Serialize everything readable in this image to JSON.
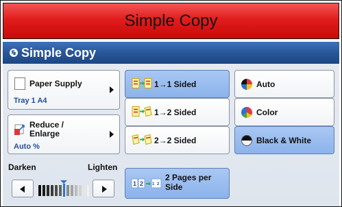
{
  "banner": {
    "title": "Simple Copy"
  },
  "header": {
    "title": "Simple Copy",
    "icon": "copy-icon"
  },
  "paper_supply": {
    "label": "Paper Supply",
    "value": "Tray 1  A4"
  },
  "reduce_enlarge": {
    "label_line1": "Reduce /",
    "label_line2": "Enlarge",
    "value": "Auto %"
  },
  "sided": {
    "items": [
      {
        "label": "1→1 Sided",
        "selected": true
      },
      {
        "label": "1→2 Sided",
        "selected": false
      },
      {
        "label": "2→2 Sided",
        "selected": false
      }
    ]
  },
  "color_mode": {
    "items": [
      {
        "label": "Auto",
        "icon": "auto-color-icon",
        "selected": false
      },
      {
        "label": "Color",
        "icon": "color-wheel-icon",
        "selected": false
      },
      {
        "label": "Black & White",
        "icon": "black-white-icon",
        "selected": true
      }
    ]
  },
  "density": {
    "darken_label": "Darken",
    "lighten_label": "Lighten",
    "level": 0.5
  },
  "pages_per_side": {
    "label_line1": "2 Pages per",
    "label_line2": "Side",
    "selected": true
  },
  "colors": {
    "banner_red": "#e21c1c",
    "header_blue": "#275597",
    "selected_blue": "#9bbdee",
    "value_blue": "#1f4ea3"
  }
}
